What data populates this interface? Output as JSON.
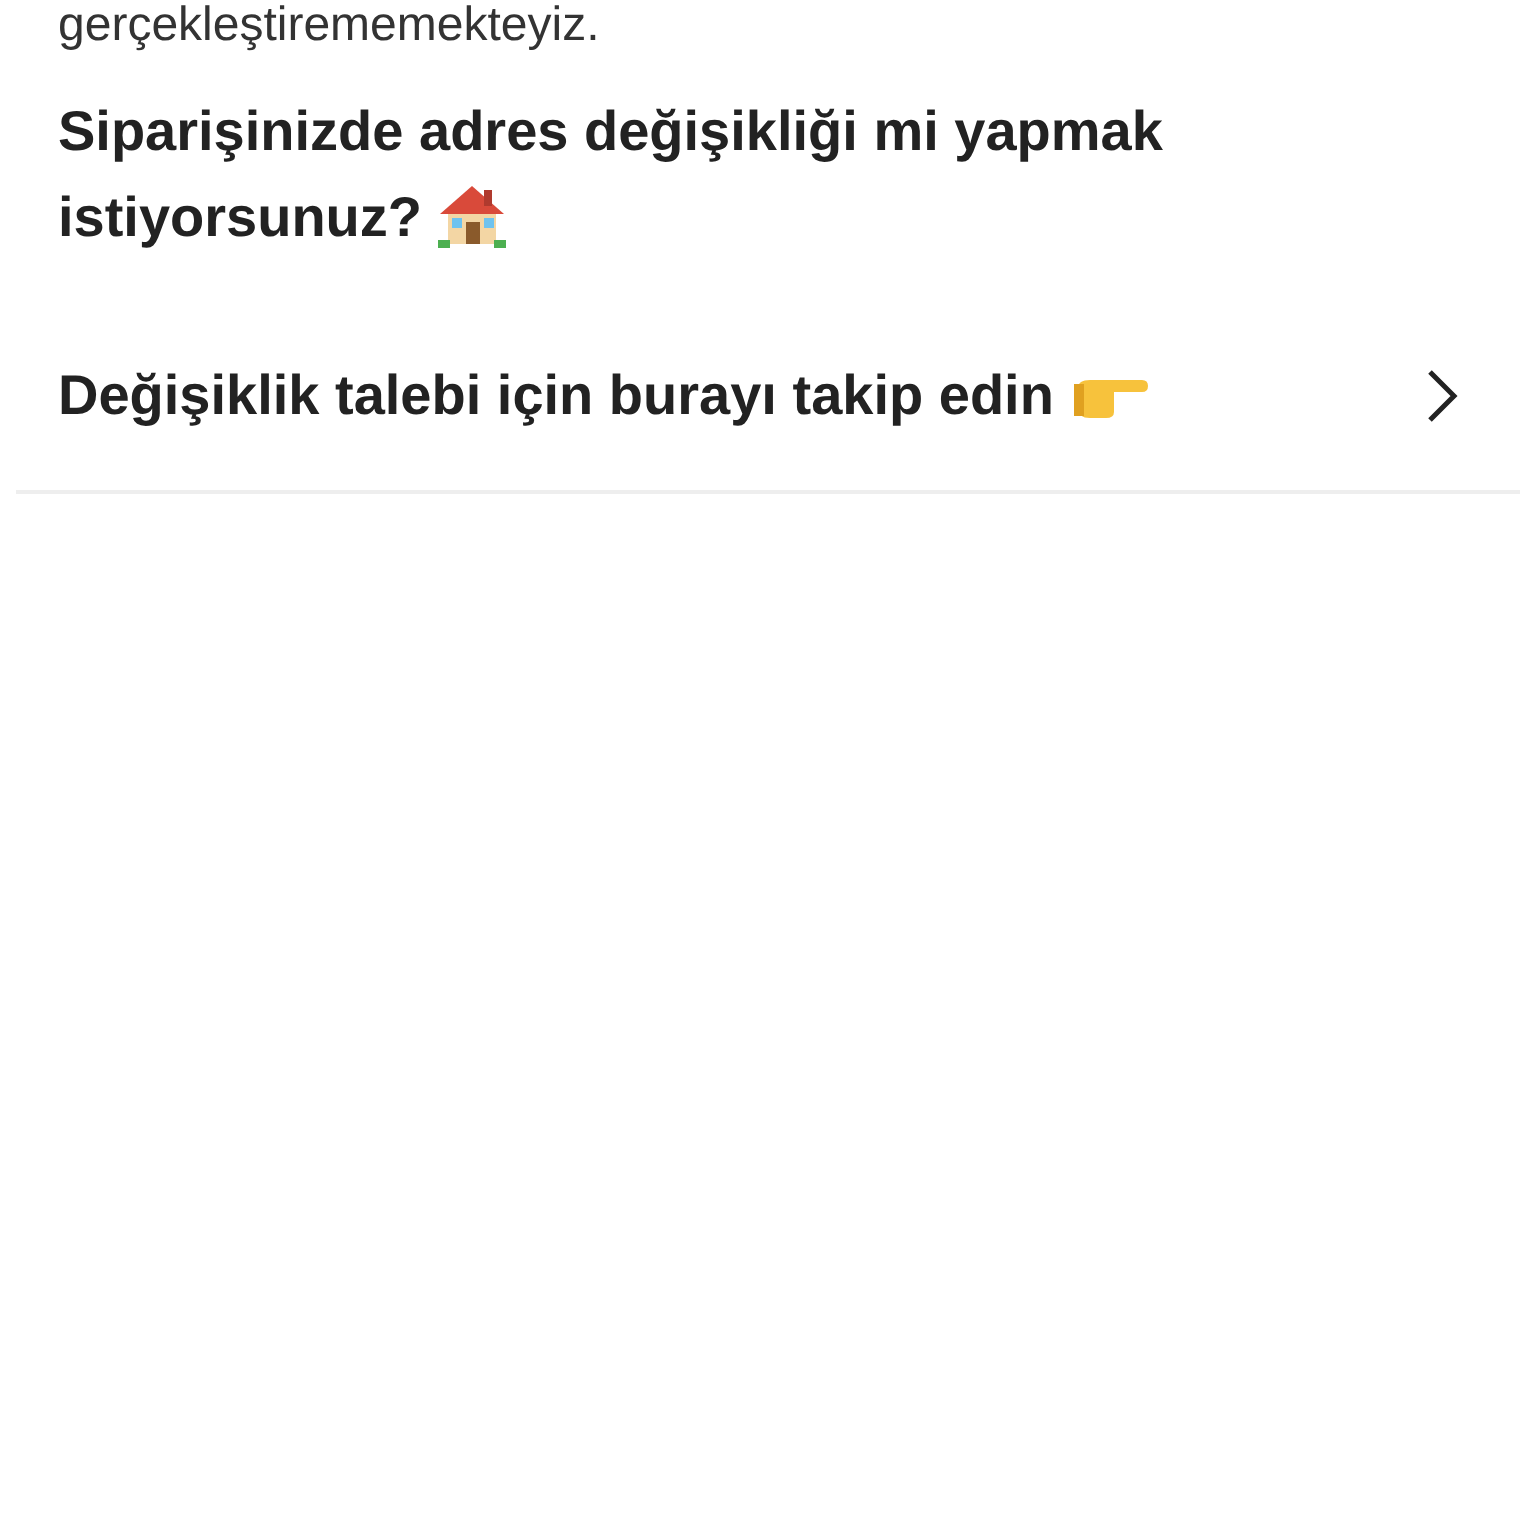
{
  "notice_text": "gerçekleştirememekteyiz.",
  "question": "Siparişinizde adres değişikliği mi yapmak istiyorsunuz?",
  "link_row": {
    "label": "Değişiklik talebi için burayı takip edin"
  }
}
